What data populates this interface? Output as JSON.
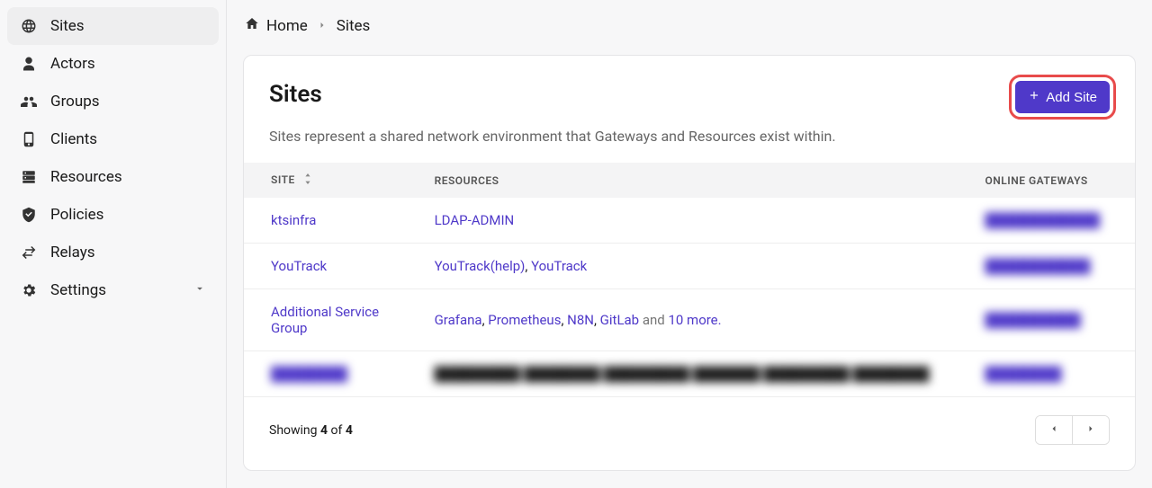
{
  "sidebar": {
    "items": [
      {
        "label": "Sites",
        "icon": "globe"
      },
      {
        "label": "Actors",
        "icon": "user"
      },
      {
        "label": "Groups",
        "icon": "users"
      },
      {
        "label": "Clients",
        "icon": "phone"
      },
      {
        "label": "Resources",
        "icon": "server"
      },
      {
        "label": "Policies",
        "icon": "shield"
      },
      {
        "label": "Relays",
        "icon": "swap"
      },
      {
        "label": "Settings",
        "icon": "gear"
      }
    ]
  },
  "breadcrumb": {
    "home": "Home",
    "current": "Sites"
  },
  "page": {
    "title": "Sites",
    "subtitle": "Sites represent a shared network environment that Gateways and Resources exist within.",
    "add_button": "Add Site"
  },
  "table": {
    "headers": {
      "site": "SITE",
      "resources": "RESOURCES",
      "gateways": "ONLINE GATEWAYS"
    },
    "rows": [
      {
        "site": "ktsinfra",
        "site_blur": false,
        "resources": [
          {
            "text": "LDAP-ADMIN",
            "link": true
          }
        ],
        "gateway": "████████████",
        "gateway_blur": true
      },
      {
        "site": "YouTrack",
        "site_blur": false,
        "resources": [
          {
            "text": "YouTrack(help)",
            "link": true
          },
          {
            "text": ", ",
            "link": false
          },
          {
            "text": "YouTrack",
            "link": true
          }
        ],
        "gateway": "███████████",
        "gateway_blur": true
      },
      {
        "site": "Additional Service Group",
        "site_blur": false,
        "resources": [
          {
            "text": "Grafana",
            "link": true
          },
          {
            "text": ", ",
            "link": false
          },
          {
            "text": "Prometheus",
            "link": true
          },
          {
            "text": ", ",
            "link": false
          },
          {
            "text": "N8N",
            "link": true
          },
          {
            "text": ", ",
            "link": false
          },
          {
            "text": "GitLab",
            "link": true
          },
          {
            "text": " and ",
            "link": false,
            "muted": true
          },
          {
            "text": "10 more.",
            "link": true
          }
        ],
        "gateway": "██████████",
        "gateway_blur": true
      },
      {
        "site": "████████",
        "site_blur": true,
        "resources": [
          {
            "text": "█████████ ████████ █████████ ███████ █████████ ████████",
            "link": false,
            "blur": true
          }
        ],
        "gateway": "████████",
        "gateway_blur": true
      }
    ]
  },
  "footer": {
    "showing_pre": "Showing ",
    "count": "4",
    "showing_mid": " of ",
    "total": "4"
  }
}
